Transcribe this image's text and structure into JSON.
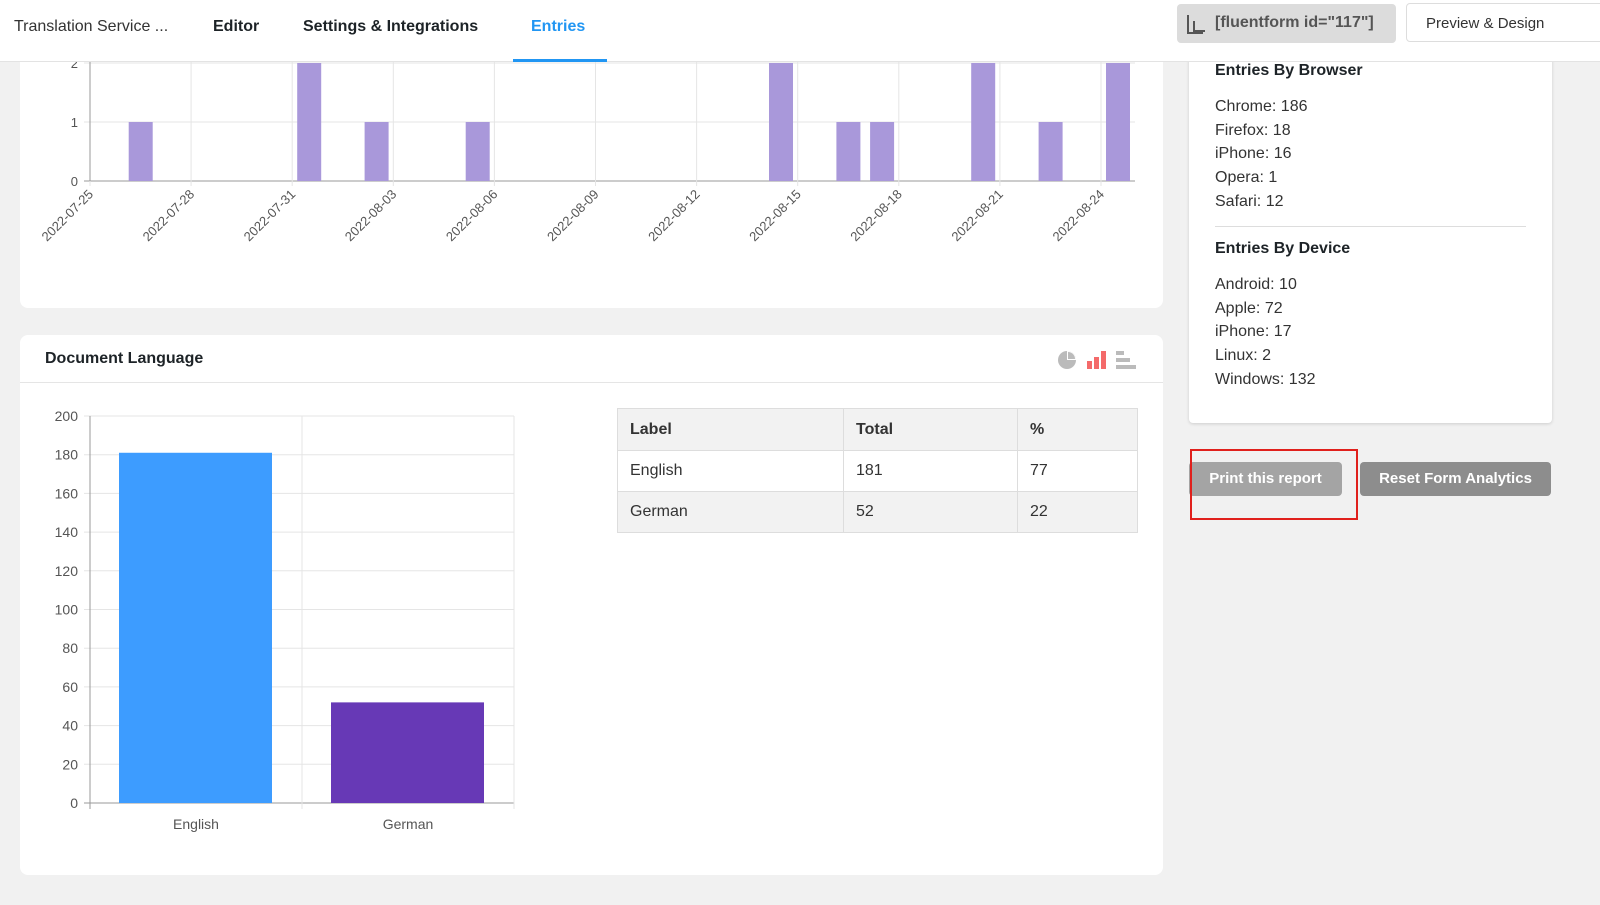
{
  "header": {
    "title": "Translation Service ...",
    "tabs": [
      {
        "label": "Editor"
      },
      {
        "label": "Settings & Integrations"
      },
      {
        "label": "Entries",
        "active": true
      }
    ],
    "shortcode": "[fluentform id=\"117\"]",
    "preview_label": "Preview & Design",
    "accent": "#2196f3"
  },
  "timeline_chart": {
    "type": "bar",
    "color": "#a998da",
    "ylim": [
      0,
      2
    ],
    "y_ticks": [
      "0",
      "1",
      "2"
    ],
    "x_ticks": [
      "2022-07-25",
      "2022-07-28",
      "2022-07-31",
      "2022-08-03",
      "2022-08-06",
      "2022-08-09",
      "2022-08-12",
      "2022-08-15",
      "2022-08-18",
      "2022-08-21",
      "2022-08-24"
    ],
    "bars": [
      {
        "x": "2022-07-26",
        "y": 1
      },
      {
        "x": "2022-07-31",
        "y": 2
      },
      {
        "x": "2022-08-02",
        "y": 1
      },
      {
        "x": "2022-08-05",
        "y": 1
      },
      {
        "x": "2022-08-14",
        "y": 2
      },
      {
        "x": "2022-08-16",
        "y": 1
      },
      {
        "x": "2022-08-17",
        "y": 1
      },
      {
        "x": "2022-08-20",
        "y": 2
      },
      {
        "x": "2022-08-22",
        "y": 1
      },
      {
        "x": "2022-08-24",
        "y": 2
      }
    ]
  },
  "language": {
    "title": "Document Language",
    "icons": [
      "pie-chart-icon",
      "bar-chart-icon",
      "horizontal-bar-icon"
    ],
    "table": {
      "headers": [
        "Label",
        "Total",
        "%"
      ],
      "rows": [
        [
          "English",
          "181",
          "77"
        ],
        [
          "German",
          "52",
          "22"
        ]
      ]
    }
  },
  "chart_data": {
    "type": "bar",
    "categories": [
      "English",
      "German"
    ],
    "values": [
      181,
      52
    ],
    "colors": [
      "#3d9cff",
      "#6739b6"
    ],
    "ylim": [
      0,
      200
    ],
    "y_ticks": [
      "0",
      "20",
      "40",
      "60",
      "80",
      "100",
      "120",
      "140",
      "160",
      "180",
      "200"
    ],
    "grid": true
  },
  "sidebar": {
    "browser": {
      "title": "Entries By Browser",
      "items": [
        "Chrome: 186",
        "Firefox: 18",
        "iPhone: 16",
        "Opera: 1",
        "Safari: 12"
      ]
    },
    "device": {
      "title": "Entries By Device",
      "items": [
        "Android: 10",
        "Apple: 72",
        "iPhone: 17",
        "Linux: 2",
        "Windows: 132"
      ]
    },
    "print_label": "Print this report",
    "reset_label": "Reset Form Analytics"
  }
}
